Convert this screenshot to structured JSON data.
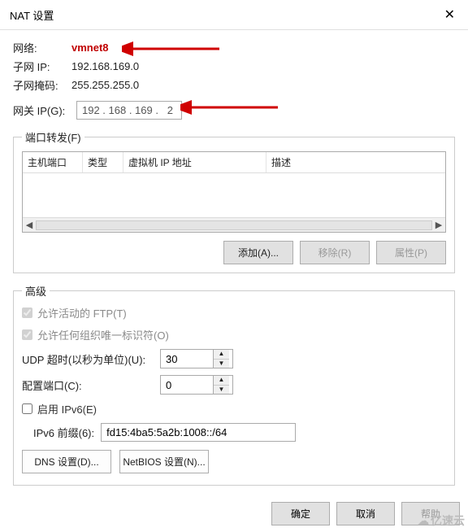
{
  "title": "NAT 设置",
  "info": {
    "network_label": "网络:",
    "network_value": "vmnet8",
    "subnet_ip_label": "子网 IP:",
    "subnet_ip_value": "192.168.169.0",
    "subnet_mask_label": "子网掩码:",
    "subnet_mask_value": "255.255.255.0",
    "gateway_label": "网关 IP(G):",
    "gateway_value": "192 . 168 . 169 .   2"
  },
  "port_fwd": {
    "legend": "端口转发(F)",
    "cols": {
      "host_port": "主机端口",
      "type": "类型",
      "vm_ip": "虚拟机 IP 地址",
      "desc": "描述"
    },
    "buttons": {
      "add": "添加(A)...",
      "remove": "移除(R)",
      "props": "属性(P)"
    }
  },
  "advanced": {
    "legend": "高级",
    "ftp": "允许活动的 FTP(T)",
    "org_id": "允许任何组织唯一标识符(O)",
    "udp_label": "UDP 超时(以秒为单位)(U):",
    "udp_value": "30",
    "config_port_label": "配置端口(C):",
    "config_port_value": "0",
    "ipv6_enable": "启用 IPv6(E)",
    "ipv6_prefix_label": "IPv6 前缀(6):",
    "ipv6_prefix_value": "fd15:4ba5:5a2b:1008::/64",
    "dns_btn": "DNS 设置(D)...",
    "netbios_btn": "NetBIOS 设置(N)..."
  },
  "footer": {
    "ok": "确定",
    "cancel": "取消",
    "help": "帮助"
  },
  "watermark": "亿速云"
}
